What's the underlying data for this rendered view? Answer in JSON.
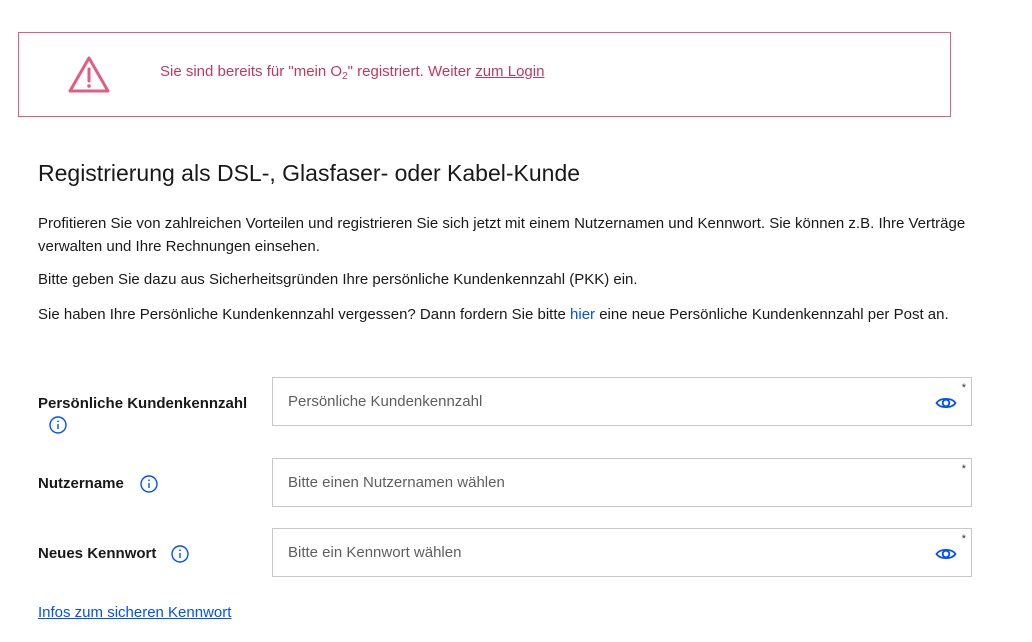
{
  "alert": {
    "text_before": "Sie sind bereits für \"mein O",
    "text_sub": "2",
    "text_after": "\" registriert. Weiter ",
    "link": "zum Login",
    "color": "#c0395c",
    "border_color": "#e25d7f",
    "icon": "warning-triangle-icon"
  },
  "title": "Registrierung als DSL-, Glasfaser- oder Kabel-Kunde",
  "paragraphs": {
    "p1": "Profitieren Sie von zahlreichen Vorteilen und registrieren Sie sich jetzt mit einem Nutzernamen und Kennwort. Sie können z.B. Ihre Verträge verwalten und Ihre Rechnungen einsehen.",
    "p2": "Bitte geben Sie dazu aus Sicherheitsgründen Ihre persönliche Kundenkennzahl (PKK) ein.",
    "p3_before": "Sie haben Ihre Persönliche Kundenkennzahl vergessen? Dann fordern Sie bitte ",
    "p3_link": "hier",
    "p3_after": " eine neue Persönliche Kundenkennzahl per Post an."
  },
  "form": {
    "pkk": {
      "label": "Persönliche Kundenkennzahl",
      "placeholder": "Persönliche Kundenkennzahl",
      "value": "",
      "required_marker": "*"
    },
    "username": {
      "label": "Nutzername",
      "placeholder": "Bitte einen Nutzernamen wählen",
      "value": "",
      "required_marker": "*"
    },
    "password": {
      "label": "Neues Kennwort",
      "placeholder": "Bitte ein Kennwort wählen",
      "value": "",
      "required_marker": "*"
    }
  },
  "bottom_link": "Infos zum sicheren Kennwort",
  "colors": {
    "link_blue": "#0050ff",
    "text": "#191919"
  }
}
